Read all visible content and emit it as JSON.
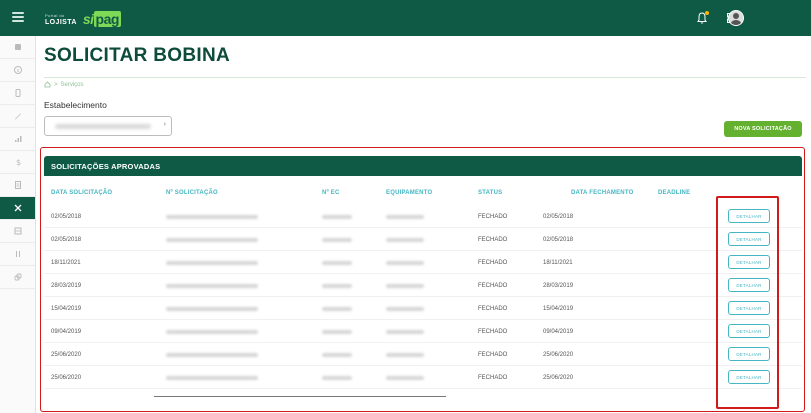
{
  "topbar": {
    "logo_top": "Portal do",
    "logo_main": "LOJISTA",
    "brand_si": "si",
    "brand_pay": "pag",
    "icons": [
      "menu-icon",
      "bell-icon",
      "grid-icon",
      "avatar"
    ]
  },
  "sidebar": {
    "items": [
      "home-icon",
      "info-icon",
      "device-icon",
      "pen-icon",
      "chart-icon",
      "dollar-icon",
      "receipt-icon",
      "tools-icon",
      "table-icon",
      "filter-icon",
      "link-icon"
    ],
    "active_index": 7
  },
  "page": {
    "title": "SOLICITAR BOBINA",
    "breadcrumb_current": "Serviços",
    "establishment_label": "Estabelecimento",
    "new_request_button": "NOVA SOLICITAÇÃO"
  },
  "table": {
    "section_title": "SOLICITAÇÕES APROVADAS",
    "headers": [
      "DATA SOLICITAÇÃO",
      "Nº SOLICITAÇÃO",
      "Nº EC",
      "EQUIPAMENTO",
      "STATUS",
      "DATA FECHAMENTO",
      "DEADLINE"
    ],
    "detail_label": "DETALHAR",
    "rows": [
      {
        "data_solicitacao": "02/05/2018",
        "status": "FECHADO",
        "data_fechamento": "02/05/2018"
      },
      {
        "data_solicitacao": "02/05/2018",
        "status": "FECHADO",
        "data_fechamento": "02/05/2018"
      },
      {
        "data_solicitacao": "18/11/2021",
        "status": "FECHADO",
        "data_fechamento": "18/11/2021"
      },
      {
        "data_solicitacao": "28/03/2019",
        "status": "FECHADO",
        "data_fechamento": "28/03/2019"
      },
      {
        "data_solicitacao": "15/04/2019",
        "status": "FECHADO",
        "data_fechamento": "15/04/2019"
      },
      {
        "data_solicitacao": "09/04/2019",
        "status": "FECHADO",
        "data_fechamento": "09/04/2019"
      },
      {
        "data_solicitacao": "25/06/2020",
        "status": "FECHADO",
        "data_fechamento": "25/06/2020"
      },
      {
        "data_solicitacao": "25/06/2020",
        "status": "FECHADO",
        "data_fechamento": "25/06/2020"
      }
    ]
  },
  "colors": {
    "topbar": "#0f5a45",
    "accent_green": "#63b12e",
    "header_text": "#46b6c3",
    "highlight": "#d11a1a"
  }
}
